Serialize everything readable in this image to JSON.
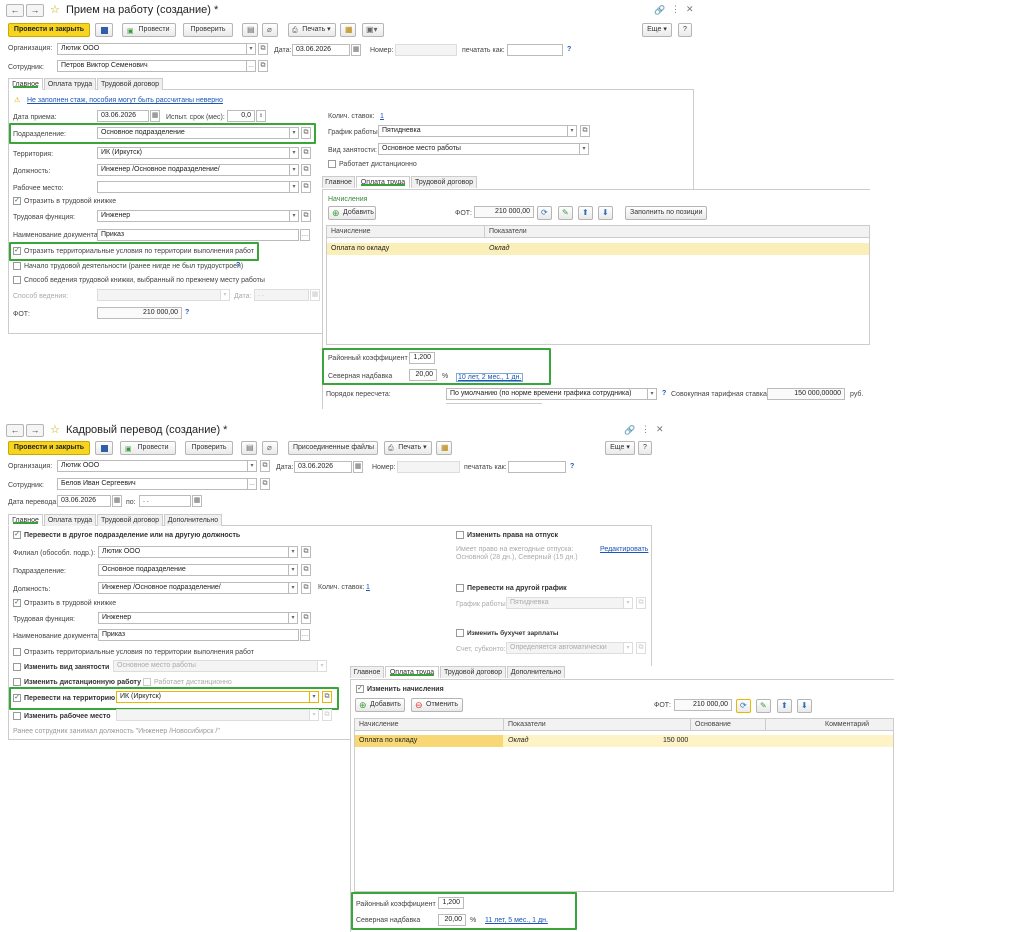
{
  "w1": {
    "title": "Прием на работу (создание) *",
    "toolbar": {
      "post_close": "Провести и закрыть",
      "post": "Провести",
      "check": "Проверить",
      "print": "Печать",
      "more": "Еще",
      "help": "?"
    },
    "org_label": "Организация:",
    "org_value": "Лютик ООО",
    "date_label": "Дата:",
    "date_value": "03.06.2026",
    "number_label": "Номер:",
    "number_value": "",
    "print_as_label": "печатать как:",
    "print_as_value": "",
    "emp_label": "Сотрудник:",
    "emp_value": "Петров Виктор Семенович",
    "tabs": [
      "Главное",
      "Оплата труда",
      "Трудовой договор"
    ],
    "warning": "Не заполнен стаж, пособия могут быть рассчитаны неверно",
    "hire_date_label": "Дата приема:",
    "hire_date_value": "03.06.2026",
    "trial_label": "Испыт. срок (мес):",
    "trial_value": "0,0",
    "rates_label": "Колич. ставок:",
    "rates_value": "1",
    "dept_label": "Подразделение:",
    "dept_value": "Основное подразделение",
    "schedule_label": "График работы:",
    "schedule_value": "Пятидневка",
    "territory_label": "Территория:",
    "territory_value": "ИК (Иркутск)",
    "employment_label": "Вид занятости:",
    "employment_value": "Основное место работы",
    "remote_label": "Работает дистанционно",
    "position_label": "Должность:",
    "position_value": "Инженер  /Основное подразделение/",
    "workplace_label": "Рабочее место:",
    "workplace_value": "",
    "workbook_label": "Отразить в трудовой книжке",
    "func_label": "Трудовая функция:",
    "func_value": "Инженер",
    "docname_label": "Наименование документа:",
    "docname_value": "Приказ",
    "terr_cond_label": "Отразить территориальные условия по территории выполнения работ",
    "start_label": "Начало трудовой деятельности (ранее нигде не был трудоустроен)",
    "method_label": "Способ ведения трудовой книжки, выбранный по прежнему месту работы",
    "way_label": "Способ ведения:",
    "way_value": "",
    "way_date_label": "Дата:",
    "way_date_value": ". .",
    "fot_label": "ФОТ:",
    "fot_value": "210 000,00",
    "inner_tabs": [
      "Главное",
      "Оплата труда",
      "Трудовой договор"
    ],
    "accruals_title": "Начисления",
    "add_button": "Добавить",
    "inner_fot_label": "ФОТ:",
    "inner_fot_value": "210 000,00",
    "fill_button": "Заполнить по позиции",
    "grid_headers": [
      "Начисление",
      "Показатели"
    ],
    "grid_row": {
      "accrual": "Оплата по окладу",
      "indicator": "Оклад"
    },
    "district_label": "Районный коэффициент",
    "district_value": "1,200",
    "north_label": "Северная надбавка",
    "north_value": "20,00",
    "north_unit": "%",
    "north_link": "10 лет, 2 мес., 1 дн.",
    "recalc_label": "Порядок пересчета:",
    "recalc_value": "По умолчанию (по норме времени графика сотрудника)",
    "tariff_label": "Совокупная тарифная ставка:",
    "tariff_value": "150 000,00000",
    "tariff_unit": "руб."
  },
  "w2": {
    "title": "Кадровый перевод (создание) *",
    "toolbar": {
      "post_close": "Провести и закрыть",
      "post": "Провести",
      "check": "Проверить",
      "attached": "Присоединенные файлы",
      "print": "Печать",
      "more": "Еще",
      "help": "?"
    },
    "org_label": "Организация:",
    "org_value": "Лютик ООО",
    "date_label": "Дата:",
    "date_value": "03.06.2026",
    "number_label": "Номер:",
    "number_value": "",
    "print_as_label": "печатать как:",
    "print_as_value": "",
    "emp_label": "Сотрудник:",
    "emp_value": "Белов Иван Сергеевич",
    "transfer_date_label": "Дата перевода:",
    "transfer_date_value": "03.06.2026",
    "to_label": "по:",
    "to_value": ". .",
    "tabs": [
      "Главное",
      "Оплата труда",
      "Трудовой договор",
      "Дополнительно"
    ],
    "transfer_dept_label": "Перевести в другое подразделение или на другую должность",
    "branch_label": "Филиал (обособл. подр.):",
    "branch_value": "Лютик ООО",
    "dept_label": "Подразделение:",
    "dept_value": "Основное подразделение",
    "position_label": "Должность:",
    "position_value": "Инженер  /Основное подразделение/",
    "rates_label": "Колич. ставок:",
    "rates_value": "1",
    "workbook_label": "Отразить в трудовой книжке",
    "func_label": "Трудовая функция:",
    "func_value": "Инженер",
    "docname_label": "Наименование документа:",
    "docname_value": "Приказ",
    "terr_cond_label": "Отразить территориальные условия по территории выполнения работ",
    "change_employment_label": "Изменить вид занятости",
    "change_employment_value": "Основное место работы",
    "change_remote_label": "Изменить дистанционную работу",
    "remote_label": "Работает дистанционно",
    "transfer_terr_label": "Перевести на территорию",
    "transfer_terr_value": "ИК (Иркутск)",
    "change_workplace_label": "Изменить рабочее место",
    "prev_position_note": "Ранее сотрудник занимал должность \"Инженер  /Новосибирск /\"",
    "vacation_label": "Изменить права на отпуск",
    "vacation_info_1": "Имеет право на ежегодные отпуска:",
    "vacation_info_2": "Основной (28 дн.), Северный (15 дн.)",
    "edit_link": "Редактировать",
    "schedule_change_label": "Перевести на другой график",
    "schedule_label": "График работы:",
    "schedule_value": "Пятидневка",
    "accounting_label": "Изменить бухучет зарплаты",
    "account_label": "Счет, субконто:",
    "account_value": "Определяется автоматически",
    "inner_tabs": [
      "Главное",
      "Оплата труда",
      "Трудовой договор",
      "Дополнительно"
    ],
    "change_accruals_label": "Изменить начисления",
    "add_button": "Добавить",
    "cancel_button": "Отменить",
    "inner_fot_label": "ФОТ:",
    "inner_fot_value": "210 000,00",
    "grid_headers": [
      "Начисление",
      "Показатели",
      "Основание",
      "Комментарий"
    ],
    "grid_row": {
      "accrual": "Оплата по окладу",
      "indicator": "Оклад",
      "amount": "150 000"
    },
    "district_label": "Районный коэффициент",
    "district_value": "1,200",
    "north_label": "Северная надбавка",
    "north_value": "20,00",
    "north_unit": "%",
    "north_link": "11 лет, 5 мес., 1 дн."
  }
}
